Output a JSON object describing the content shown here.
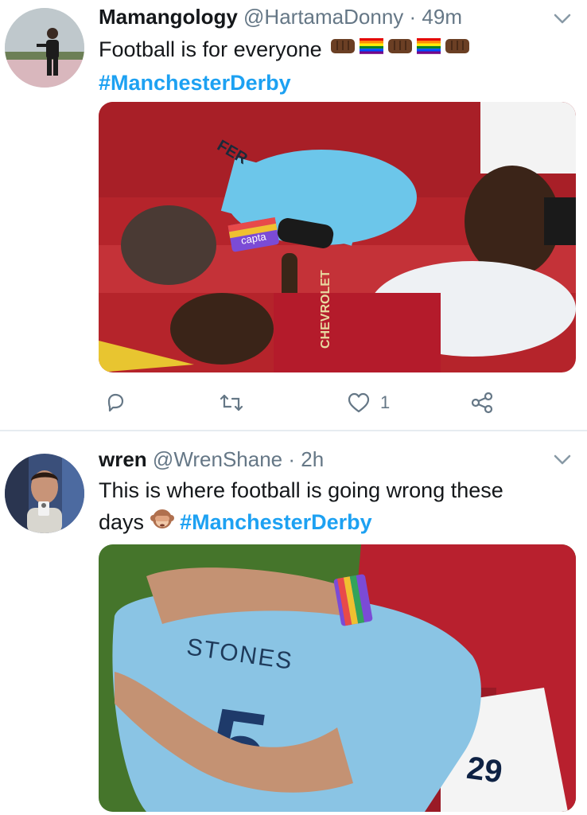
{
  "tweets": [
    {
      "name": "Mamangology",
      "handle": "@HartamaDonny",
      "separator": "·",
      "time": "49m",
      "text_line1": "Football is for everyone",
      "hashtag": "#ManchesterDerby",
      "actions": {
        "like_count": "1"
      }
    },
    {
      "name": "wren",
      "handle": "@WrenShane",
      "separator": "·",
      "time": "2h",
      "text_line1": "This is where football is going wrong these",
      "text_line2_prefix": "days",
      "hashtag": "#ManchesterDerby"
    }
  ],
  "media_text": {
    "jersey_name_1": "FER",
    "armband_1": "capta",
    "sponsor": "CHEVROLET",
    "jersey_name_2": "STONES",
    "jersey_number_2": "5",
    "shorts_number": "29"
  },
  "colors": {
    "accent": "#1da1f2",
    "secondary_text": "#657786",
    "divider": "#e6ecf0",
    "city_blue": "#6cc6ea",
    "united_red": "#b3182a"
  },
  "icons": [
    "chevron-down-icon",
    "reply-icon",
    "retweet-icon",
    "heart-icon",
    "share-icon",
    "raised-fist-icon",
    "rainbow-flag-icon",
    "see-no-evil-monkey-icon"
  ]
}
